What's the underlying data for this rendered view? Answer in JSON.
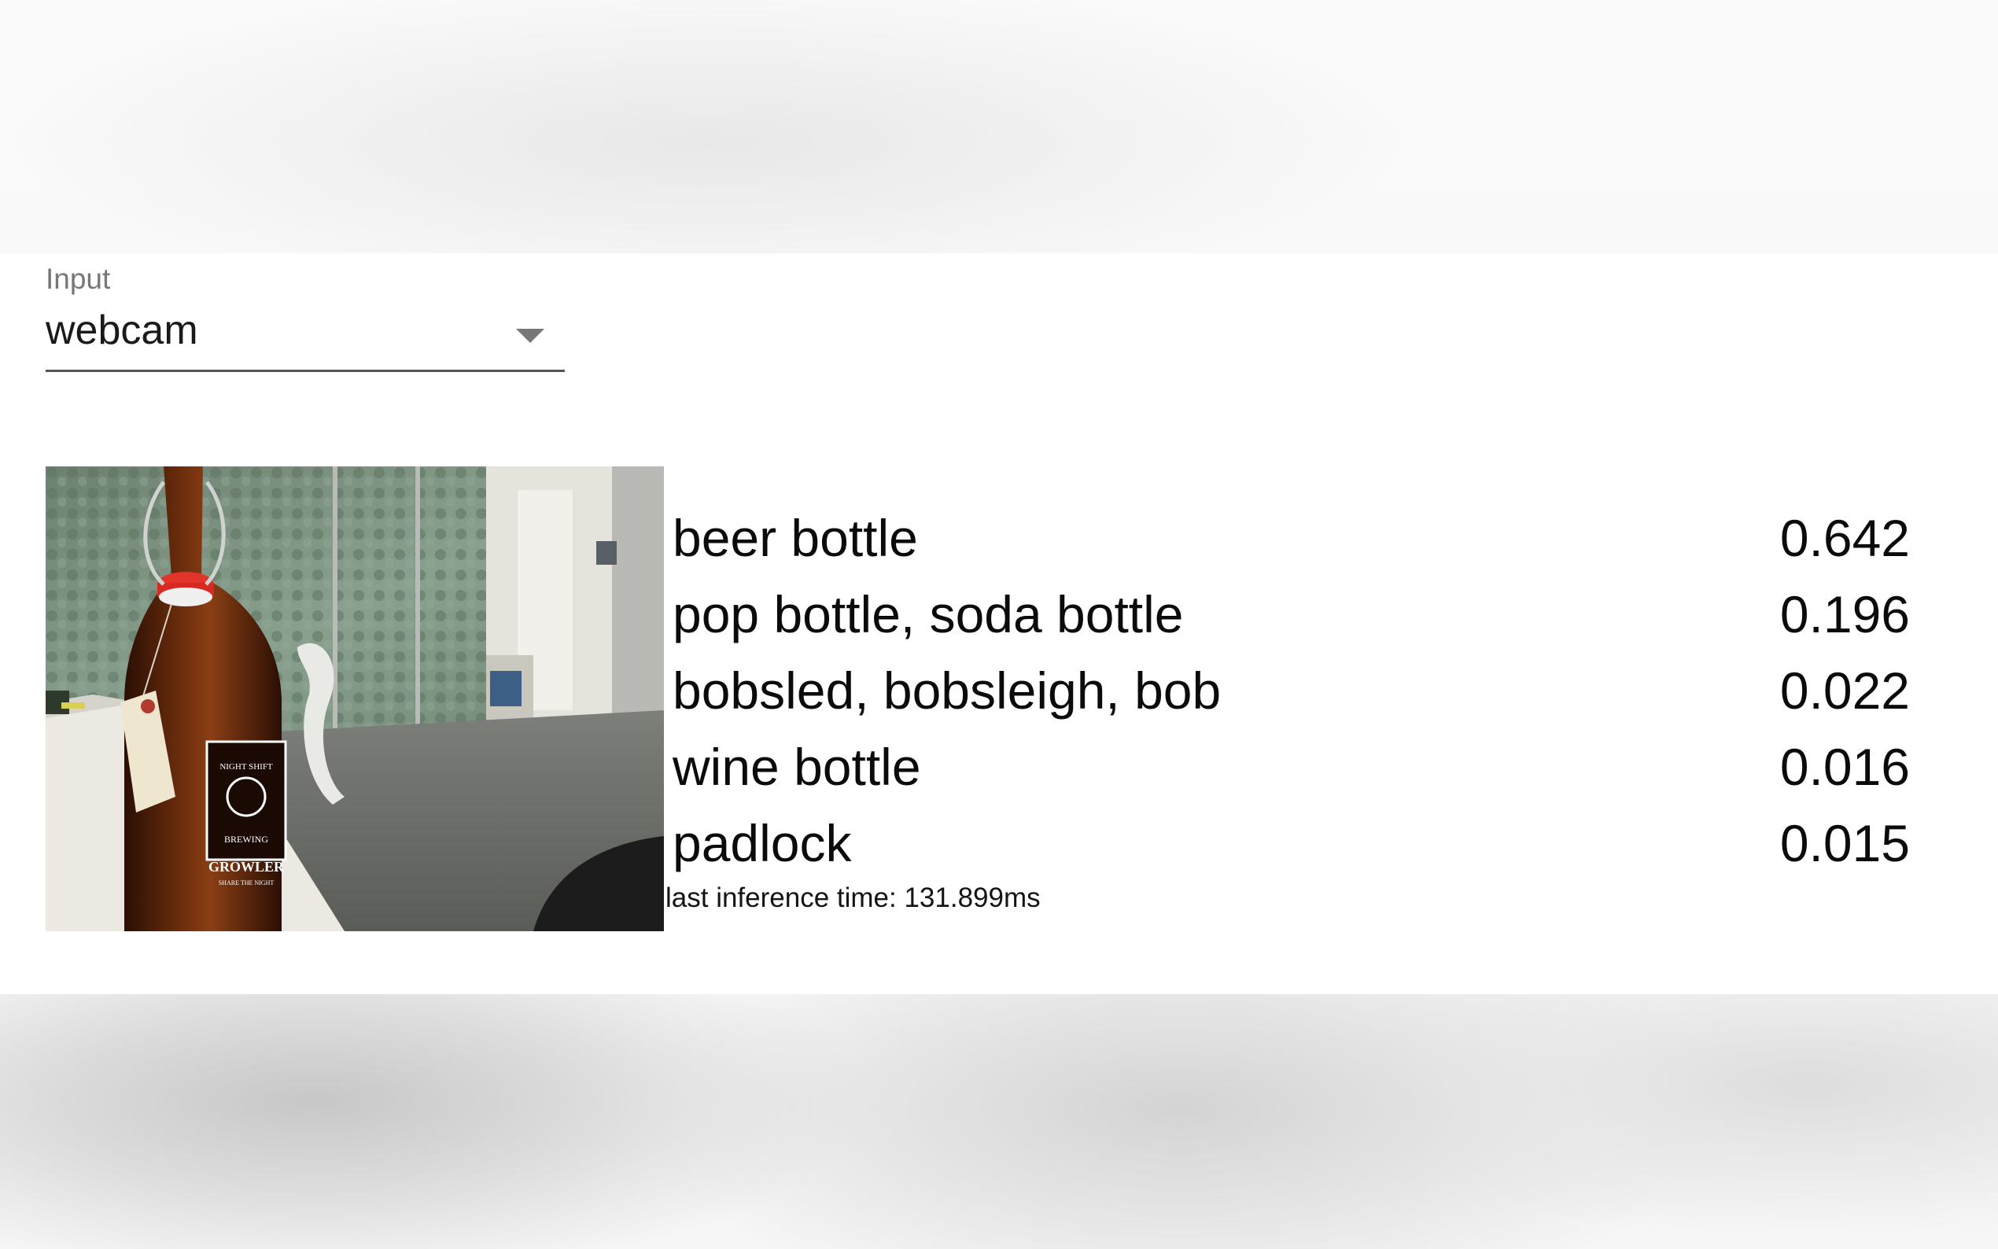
{
  "input": {
    "label": "Input",
    "selected": "webcam"
  },
  "webcam": {
    "bottle_label": {
      "brand_top": "NIGHT SHIFT",
      "brand_bottom": "BREWING",
      "product": "GROWLER",
      "tagline": "SHARE THE NIGHT"
    }
  },
  "predictions": [
    {
      "label": "beer bottle",
      "score": "0.642"
    },
    {
      "label": "pop bottle, soda bottle",
      "score": "0.196"
    },
    {
      "label": "bobsled, bobsleigh, bob",
      "score": "0.022"
    },
    {
      "label": "wine bottle",
      "score": "0.016"
    },
    {
      "label": "padlock",
      "score": "0.015"
    }
  ],
  "status": {
    "inference_time": "last inference time: 131.899ms"
  }
}
